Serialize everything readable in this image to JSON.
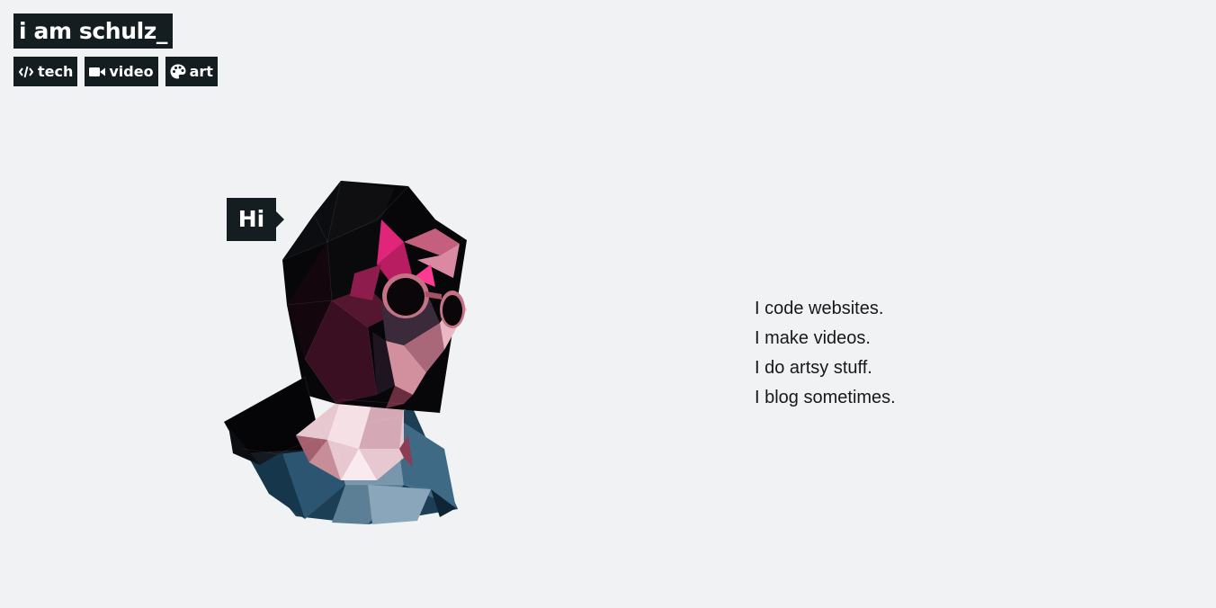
{
  "site": {
    "title": "i am schulz_"
  },
  "nav": {
    "items": [
      {
        "label": "tech",
        "icon": "code-icon"
      },
      {
        "label": "video",
        "icon": "video-camera-icon"
      },
      {
        "label": "art",
        "icon": "palette-icon"
      }
    ]
  },
  "hero": {
    "greeting": "Hi",
    "taglines": [
      "I code websites.",
      "I make videos.",
      "I do artsy stuff.",
      "I blog sometimes."
    ]
  },
  "colors": {
    "background": "#f1f2f4",
    "dark": "#141e20",
    "text": "#15191c",
    "accent_pink": "#e0257a",
    "accent_blue": "#3e6a86"
  }
}
